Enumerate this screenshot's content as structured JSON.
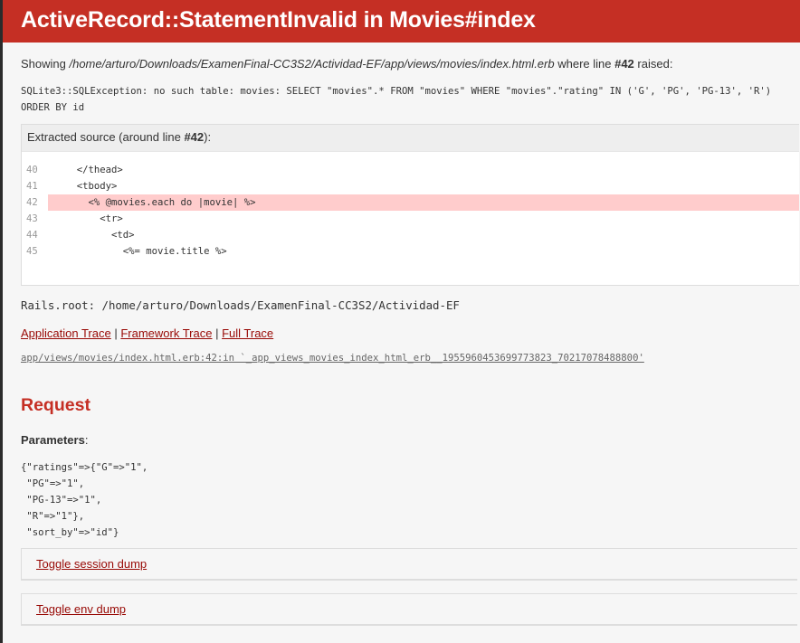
{
  "header": {
    "title": "ActiveRecord::StatementInvalid in Movies#index"
  },
  "showing": {
    "prefix": "Showing ",
    "path": "/home/arturo/Downloads/ExamenFinal-CC3S2/Actividad-EF/app/views/movies/index.html.erb",
    "middle": " where line ",
    "line": "#42",
    "suffix": " raised:"
  },
  "exception": "SQLite3::SQLException: no such table: movies: SELECT \"movies\".* FROM \"movies\" WHERE \"movies\".\"rating\" IN ('G', 'PG', 'PG-13', 'R')  ORDER BY id",
  "source": {
    "header_prefix": "Extracted source (around line ",
    "header_line": "#42",
    "header_suffix": "):",
    "lines": [
      {
        "num": "40",
        "code": "  </thead>",
        "highlight": false
      },
      {
        "num": "41",
        "code": "  <tbody>",
        "highlight": false
      },
      {
        "num": "42",
        "code": "    <% @movies.each do |movie| %>",
        "highlight": true
      },
      {
        "num": "43",
        "code": "      <tr>",
        "highlight": false
      },
      {
        "num": "44",
        "code": "        <td>",
        "highlight": false
      },
      {
        "num": "45",
        "code": "          <%= movie.title %>",
        "highlight": false
      }
    ]
  },
  "rails_root": "Rails.root: /home/arturo/Downloads/ExamenFinal-CC3S2/Actividad-EF",
  "traces": {
    "application": "Application Trace",
    "framework": "Framework Trace",
    "full": "Full Trace",
    "separator": " | "
  },
  "trace_line": "app/views/movies/index.html.erb:42:in `_app_views_movies_index_html_erb__1955960453699773823_70217078488800'",
  "request": {
    "heading": "Request",
    "params_label": "Parameters",
    "params_colon": ":",
    "params": "{\"ratings\"=>{\"G\"=>\"1\",\n \"PG\"=>\"1\",\n \"PG-13\"=>\"1\",\n \"R\"=>\"1\"},\n \"sort_by\"=>\"id\"}"
  },
  "dumps": {
    "session": "Toggle session dump",
    "env": "Toggle env dump"
  },
  "colors": {
    "header_bg": "#c52f24",
    "link": "#980905",
    "highlight": "#ffcccc"
  }
}
